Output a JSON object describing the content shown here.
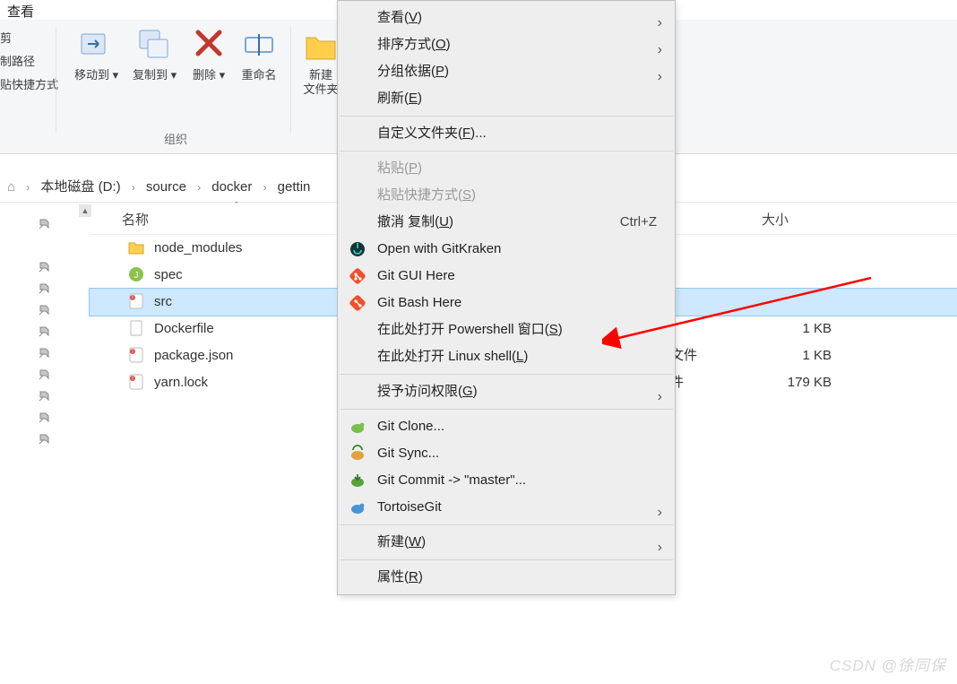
{
  "ribbon": {
    "tab": "查看",
    "clipboard": {
      "cut": "剪",
      "copy_path": "制路径",
      "paste_shortcut": "贴快捷方式"
    },
    "organize": {
      "move_to": "移动到",
      "copy_to": "复制到",
      "delete": "删除",
      "rename": "重命名",
      "group": "组织"
    },
    "new": {
      "new_folder_l1": "新建",
      "new_folder_l2": "文件夹"
    }
  },
  "breadcrumb": {
    "parts": [
      "本地磁盘 (D:)",
      "source",
      "docker",
      "gettin"
    ]
  },
  "cols": {
    "name": "名称",
    "size": "大小"
  },
  "files": [
    {
      "name": "node_modules",
      "kind": "folder",
      "type": "",
      "size": ""
    },
    {
      "name": "spec",
      "kind": "js",
      "type": "",
      "size": ""
    },
    {
      "name": "src",
      "kind": "code",
      "type": "",
      "size": "",
      "selected": true
    },
    {
      "name": "Dockerfile",
      "kind": "file",
      "type": "",
      "size": "1 KB"
    },
    {
      "name": "package.json",
      "kind": "code",
      "type": "文件",
      "size": "1 KB"
    },
    {
      "name": "yarn.lock",
      "kind": "code",
      "type": "件",
      "size": "179 KB"
    }
  ],
  "ctx": {
    "view": "查看(V)",
    "sort": "排序方式(O)",
    "group": "分组依据(P)",
    "refresh": "刷新(E)",
    "customize": "自定义文件夹(F)...",
    "paste": "粘贴(P)",
    "paste_shortcut": "粘贴快捷方式(S)",
    "undo_copy": "撤消 复制(U)",
    "undo_accel": "Ctrl+Z",
    "gitkraken": "Open with GitKraken",
    "git_gui": "Git GUI Here",
    "git_bash": "Git Bash Here",
    "powershell": "在此处打开 Powershell 窗口(S)",
    "linuxshell": "在此处打开 Linux shell(L)",
    "grant_access": "授予访问权限(G)",
    "git_clone": "Git Clone...",
    "git_sync": "Git Sync...",
    "git_commit": "Git Commit -> \"master\"...",
    "tortoisegit": "TortoiseGit",
    "new": "新建(W)",
    "properties": "属性(R)"
  },
  "watermark": "CSDN @徐同保"
}
